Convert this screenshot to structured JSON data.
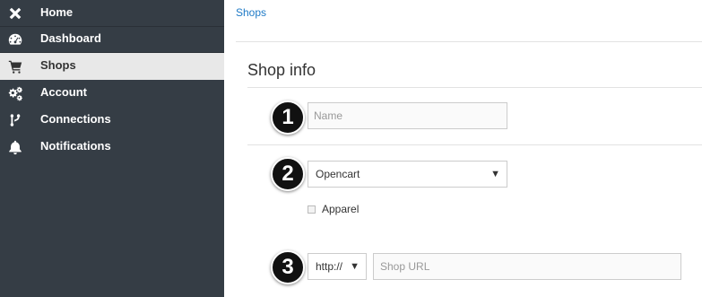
{
  "sidebar": {
    "items": [
      {
        "label": "Home",
        "icon": "close-icon"
      },
      {
        "label": "Dashboard",
        "icon": "dashboard-icon"
      },
      {
        "label": "Shops",
        "icon": "cart-icon",
        "active": true
      },
      {
        "label": "Account",
        "icon": "gears-icon"
      },
      {
        "label": "Connections",
        "icon": "branch-icon"
      },
      {
        "label": "Notifications",
        "icon": "bell-icon"
      }
    ]
  },
  "breadcrumb": "Shops",
  "main": {
    "section_title": "Shop info",
    "name_placeholder": "Name",
    "platform_value": "Opencart",
    "apparel_label": "Apparel",
    "protocol_value": "http://",
    "url_placeholder": "Shop URL",
    "callouts": [
      "1",
      "2",
      "3"
    ]
  },
  "colors": {
    "sidebar_bg": "#353d45",
    "active_item_bg": "#e8e8e8",
    "link": "#1e7ac6"
  }
}
